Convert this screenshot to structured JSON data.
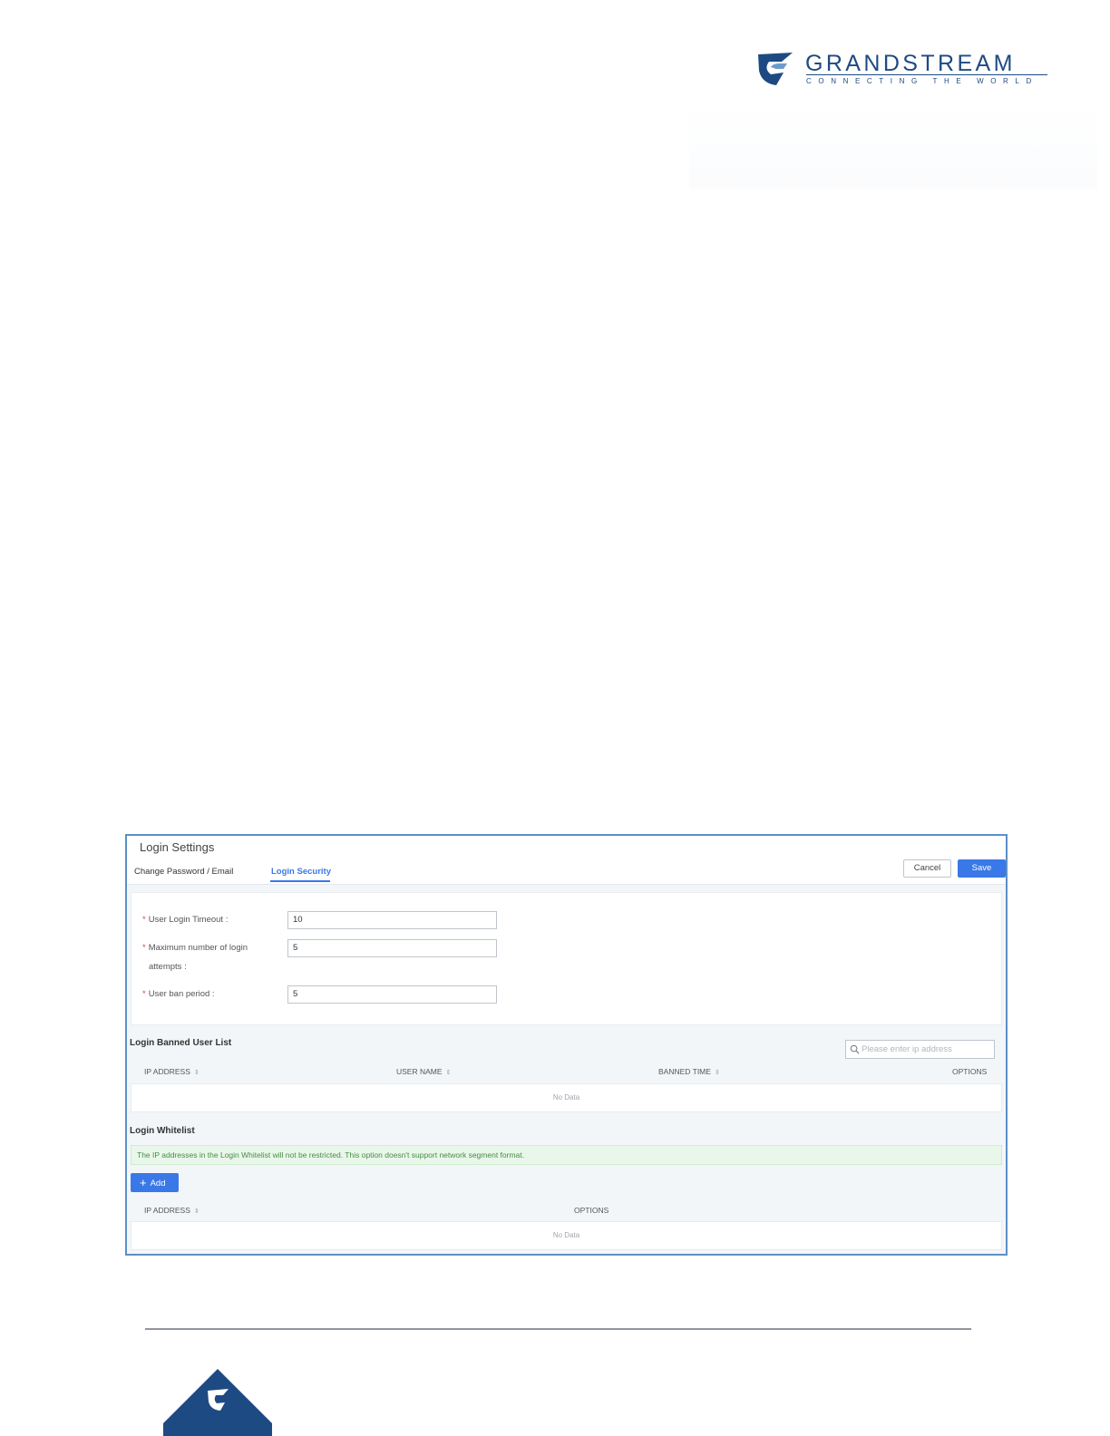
{
  "header": {
    "brand_name": "GRANDSTREAM",
    "brand_tagline": "CONNECTING THE WORLD",
    "brand_color": "#1e4a83"
  },
  "login_settings": {
    "title": "Login Settings",
    "tabs": [
      {
        "label": "Change Password / Email",
        "active": false
      },
      {
        "label": "Login Security",
        "active": true
      }
    ],
    "cancel_label": "Cancel",
    "save_label": "Save",
    "accent_color": "#3a78e8",
    "fields": [
      {
        "label": "User Login Timeout :",
        "value": "10",
        "required": true
      },
      {
        "label": "Maximum number of login",
        "label_cont": "attempts :",
        "value": "5",
        "required": true
      },
      {
        "label": "User ban period :",
        "value": "5",
        "required": true
      }
    ],
    "banned_list": {
      "title": "Login Banned User List",
      "search_placeholder": "Please enter ip address",
      "columns": [
        "IP ADDRESS",
        "USER NAME",
        "BANNED TIME",
        "OPTIONS"
      ],
      "empty_text": "No Data"
    },
    "whitelist": {
      "title": "Login Whitelist",
      "notice": "The IP addresses in the Login Whitelist will not be restricted. This option doesn't support network segment format.",
      "add_label": "Add",
      "columns": [
        "IP ADDRESS",
        "OPTIONS"
      ],
      "empty_text": "No Data"
    }
  }
}
